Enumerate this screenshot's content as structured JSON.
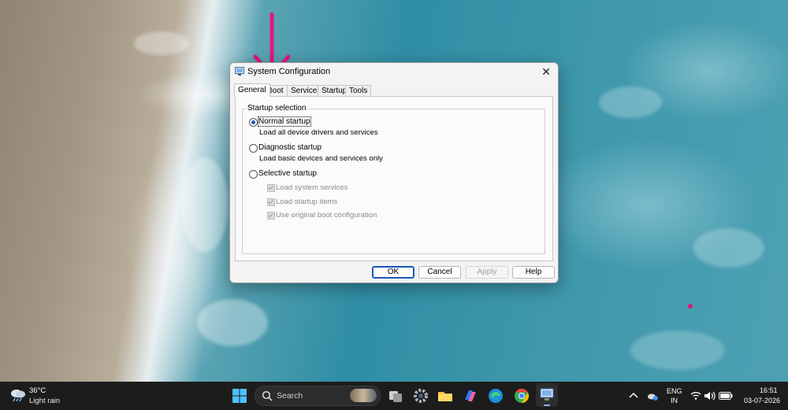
{
  "window": {
    "title": "System Configuration",
    "close_glyph": "✕",
    "tabs": [
      {
        "label": "General",
        "active": true
      },
      {
        "label": "Boot",
        "active": false
      },
      {
        "label": "Services",
        "active": false
      },
      {
        "label": "Startup",
        "active": false
      },
      {
        "label": "Tools",
        "active": false
      }
    ],
    "group_label": "Startup selection",
    "options": [
      {
        "label": "Normal startup",
        "description": "Load all device drivers and services",
        "selected": true
      },
      {
        "label": "Diagnostic startup",
        "description": "Load basic devices and services only",
        "selected": false
      },
      {
        "label": "Selective startup",
        "description": "",
        "selected": false
      }
    ],
    "checkboxes": [
      {
        "label": "Load system services",
        "checked": true,
        "enabled": false
      },
      {
        "label": "Load startup items",
        "checked": true,
        "enabled": false
      },
      {
        "label": "Use original boot configuration",
        "checked": true,
        "enabled": false
      }
    ],
    "buttons": {
      "ok": "OK",
      "cancel": "Cancel",
      "apply": "Apply",
      "help": "Help"
    }
  },
  "taskbar": {
    "weather": {
      "temp": "36°C",
      "condition": "Light rain"
    },
    "search_placeholder": "Search",
    "pinned_icons": [
      "start-icon",
      "search-icon",
      "task-view-icon",
      "settings-icon",
      "file-explorer-icon",
      "copilot-icon",
      "edge-icon",
      "chrome-icon",
      "system-configuration-icon"
    ],
    "tray": {
      "language_line1": "ENG",
      "language_line2": "IN",
      "time": "16:51",
      "date": "03-07-2026"
    }
  },
  "annotations": {
    "arrow_color": "#e2187a",
    "dot_color": "#e2187a"
  },
  "colors": {
    "accent": "#1a56b8",
    "taskbar_bg": "#1c1c1c"
  }
}
